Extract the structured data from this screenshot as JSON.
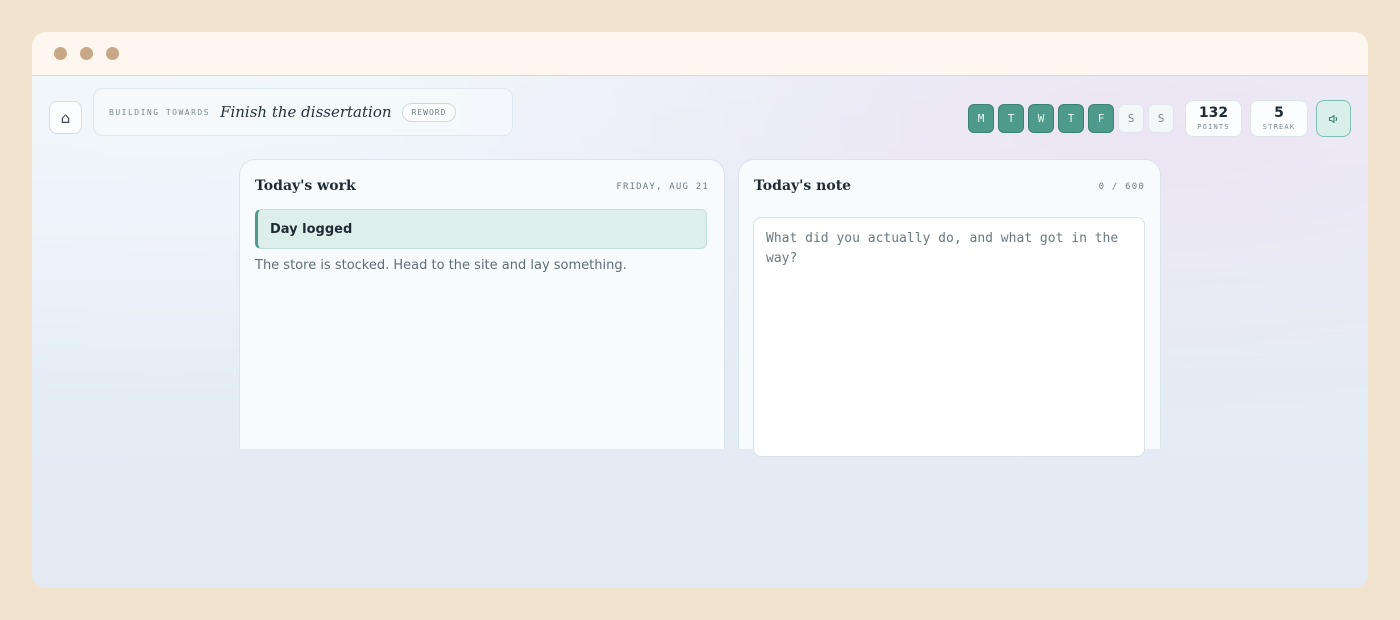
{
  "window": {
    "controls": [
      "dot-1",
      "dot-2",
      "dot-3"
    ]
  },
  "header": {
    "home_icon": "home-icon",
    "home_glyph": "⌂",
    "goal": {
      "kicker": "BUILDING TOWARDS",
      "title": "Finish the dissertation",
      "reword_label": "REWORD"
    },
    "week": [
      {
        "label": "M",
        "done": true
      },
      {
        "label": "T",
        "done": true
      },
      {
        "label": "W",
        "done": true
      },
      {
        "label": "T",
        "done": true
      },
      {
        "label": "F",
        "done": true
      },
      {
        "label": "S",
        "done": false
      },
      {
        "label": "S",
        "done": false
      }
    ],
    "points": {
      "value": "132",
      "label": "POINTS"
    },
    "streak": {
      "value": "5",
      "label": "STREAK"
    },
    "sound_icon": "speaker-icon"
  },
  "work": {
    "title": "Today's work",
    "date": "FRIDAY, AUG 21",
    "status": "Day logged",
    "message": "The store is stocked. Head to the site and lay something."
  },
  "note": {
    "title": "Today's note",
    "counter": "0 / 600",
    "value": "",
    "placeholder": "What did you actually do, and what got in the way?"
  },
  "colors": {
    "accent": "#4e9b8e",
    "accent_light": "#deefeb",
    "frame": "#f2e3cf"
  }
}
